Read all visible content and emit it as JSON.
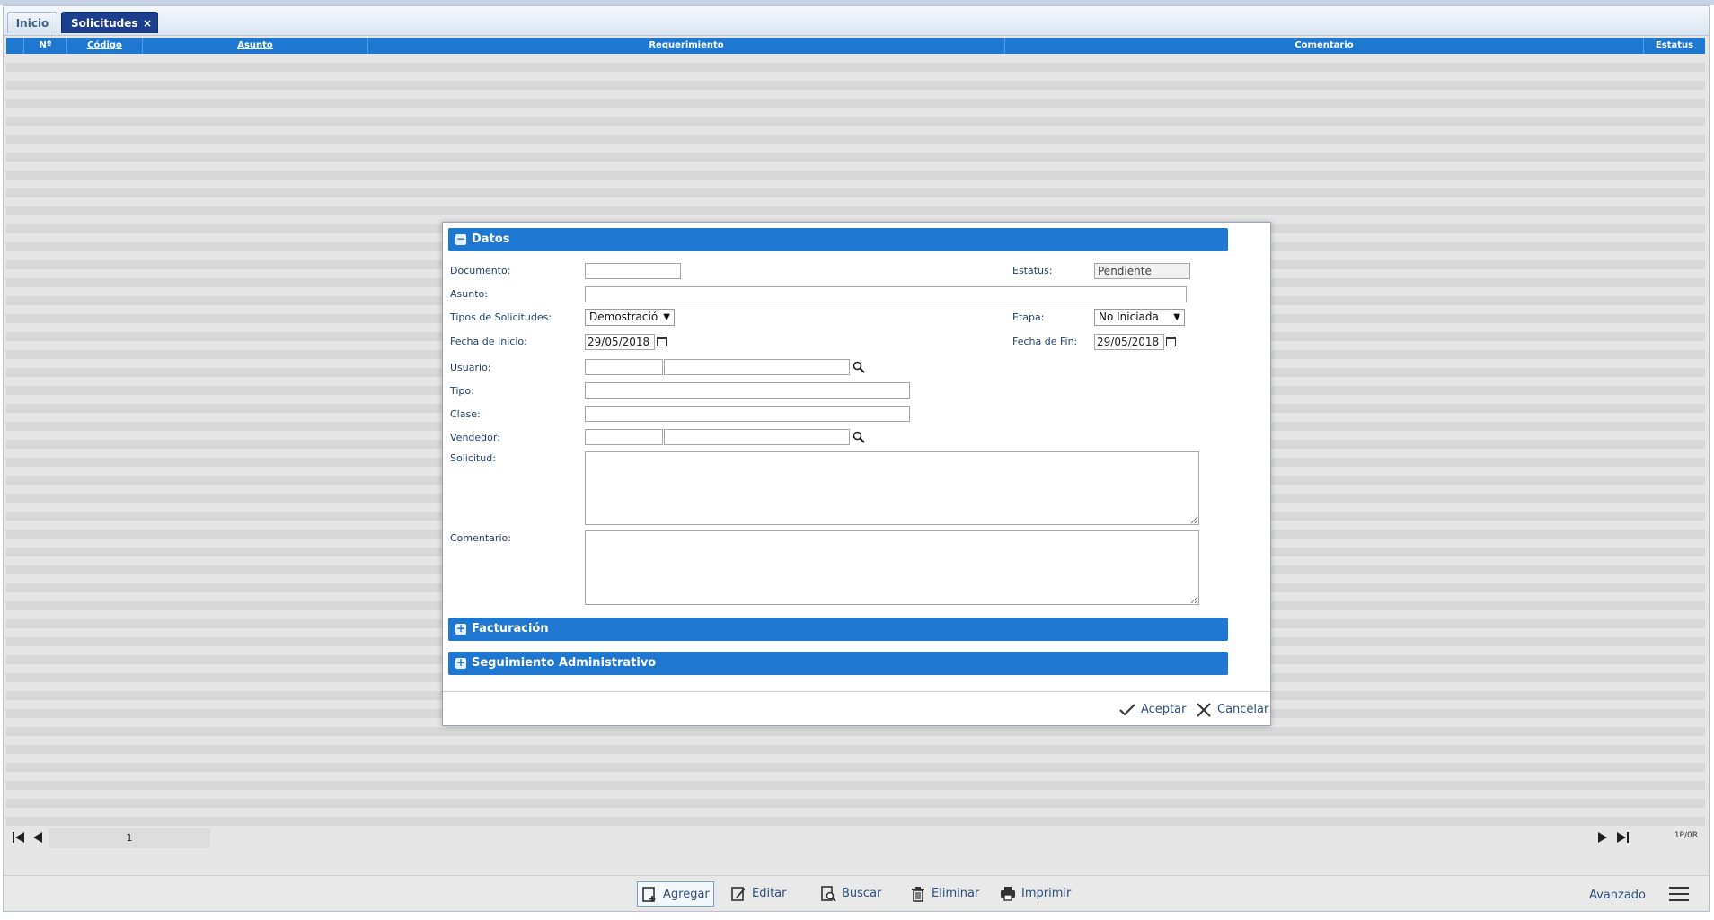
{
  "tabs": [
    {
      "label": "Inicio"
    },
    {
      "label": "Solicitudes",
      "close": "×"
    }
  ],
  "grid": {
    "columns": [
      "Nº",
      "Código",
      "Asunto",
      "Requerimiento",
      "Comentario",
      "Estatus"
    ]
  },
  "pager": {
    "page": "1",
    "count": "1P/0R"
  },
  "toolbar": {
    "add": "Agregar",
    "edit": "Editar",
    "search": "Buscar",
    "delete": "Eliminar",
    "print": "Imprimir",
    "advanced": "Avanzado"
  },
  "dialog": {
    "sections": {
      "datos": "Datos",
      "facturacion": "Facturación",
      "seguimiento": "Seguimiento Administrativo"
    },
    "labels": {
      "documento": "Documento:",
      "estatus": "Estatus:",
      "asunto": "Asunto:",
      "tipos": "Tipos de Solicitudes:",
      "etapa": "Etapa:",
      "fecha_inicio": "Fecha de Inicio:",
      "fecha_fin": "Fecha de Fin:",
      "usuario": "Usuario:",
      "tipo": "Tipo:",
      "clase": "Clase:",
      "vendedor": "Vendedor:",
      "solicitud": "Solicitud:",
      "comentario": "Comentario:"
    },
    "values": {
      "estatus": "Pendiente",
      "tipos": "Demostració",
      "etapa": "No Iniciada",
      "fecha_inicio": "29/05/2018",
      "fecha_fin": "29/05/2018"
    },
    "buttons": {
      "accept": "Aceptar",
      "cancel": "Cancelar"
    }
  },
  "colors": {
    "accent": "#1e77d0",
    "tab_active": "#1b3f8c"
  }
}
